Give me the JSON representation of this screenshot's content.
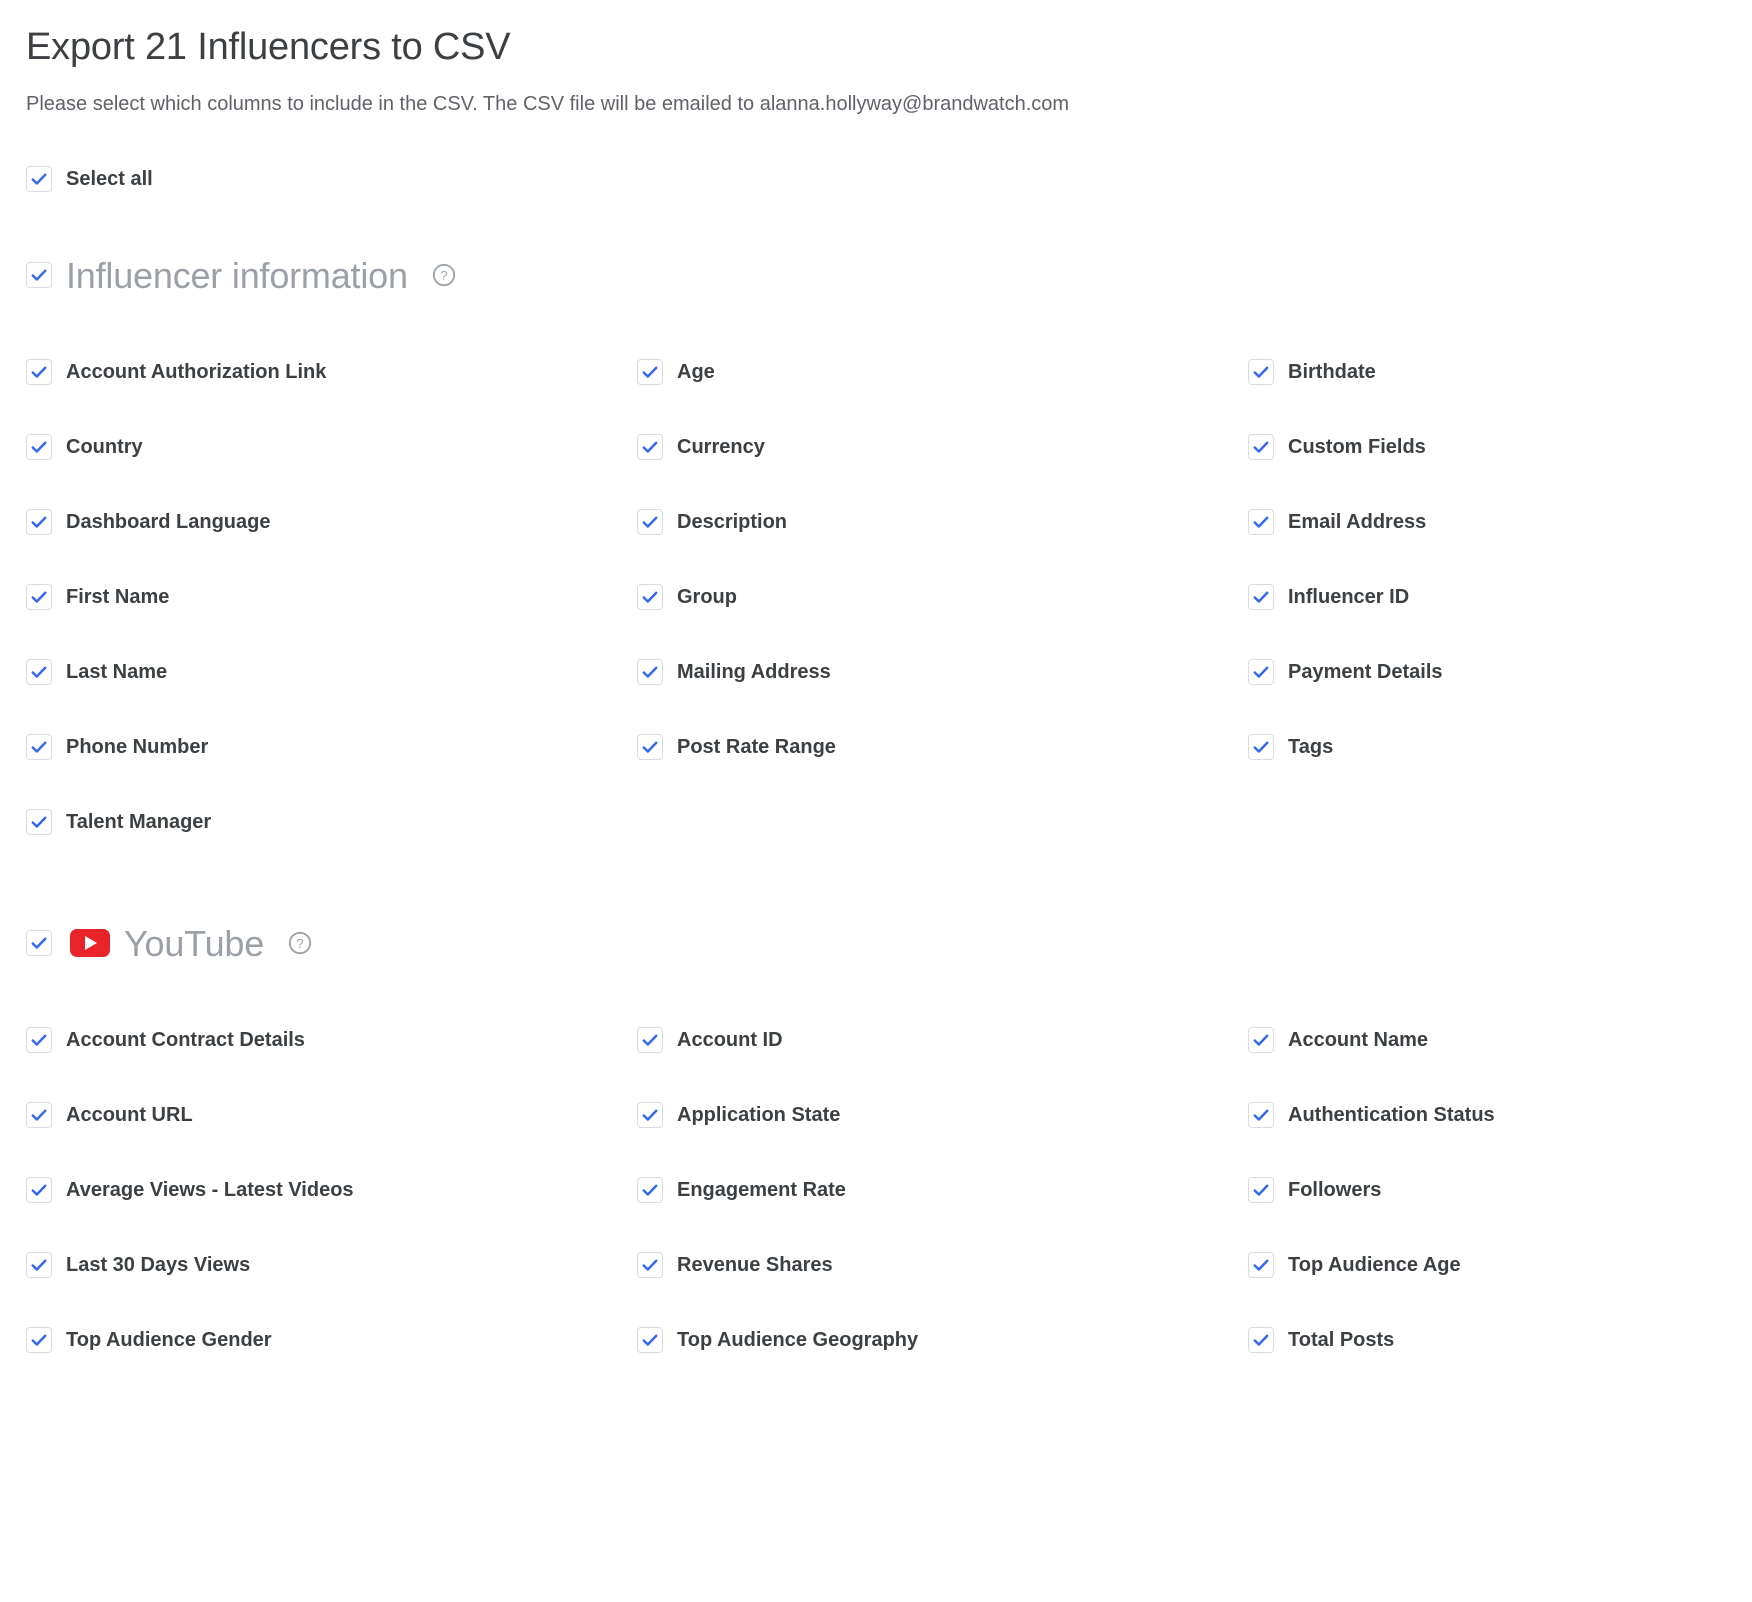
{
  "dialog": {
    "title": "Export 21 Influencers to CSV",
    "subtitle": "Please select which columns to include in the CSV. The CSV file will be emailed to alanna.hollyway@brandwatch.com",
    "select_all_label": "Select all"
  },
  "colors": {
    "accent": "#1a73e8",
    "checkmark": "#3367f0",
    "title_text": "#3c4043",
    "subtitle_text": "#5f6368",
    "section_title": "#9aa0a6",
    "checkbox_border": "#dadce0",
    "youtube_red": "#e8242a",
    "help_icon": "#9aa0a6"
  },
  "sections": [
    {
      "id": "influencer-information",
      "title": "Influencer information",
      "checked": true,
      "has_help_icon": true,
      "help_icon": "help-circle-icon",
      "logo": null,
      "items": [
        {
          "label": "Account Authorization Link",
          "checked": true
        },
        {
          "label": "Age",
          "checked": true
        },
        {
          "label": "Birthdate",
          "checked": true
        },
        {
          "label": "Country",
          "checked": true
        },
        {
          "label": "Currency",
          "checked": true
        },
        {
          "label": "Custom Fields",
          "checked": true
        },
        {
          "label": "Dashboard Language",
          "checked": true
        },
        {
          "label": "Description",
          "checked": true
        },
        {
          "label": "Email Address",
          "checked": true
        },
        {
          "label": "First Name",
          "checked": true
        },
        {
          "label": "Group",
          "checked": true
        },
        {
          "label": "Influencer ID",
          "checked": true
        },
        {
          "label": "Last Name",
          "checked": true
        },
        {
          "label": "Mailing Address",
          "checked": true
        },
        {
          "label": "Payment Details",
          "checked": true
        },
        {
          "label": "Phone Number",
          "checked": true
        },
        {
          "label": "Post Rate Range",
          "checked": true
        },
        {
          "label": "Tags",
          "checked": true
        },
        {
          "label": "Talent Manager",
          "checked": true
        }
      ]
    },
    {
      "id": "youtube",
      "title": "YouTube",
      "checked": true,
      "has_help_icon": true,
      "help_icon": "help-circle-icon",
      "logo": "youtube-logo-icon",
      "items": [
        {
          "label": "Account Contract Details",
          "checked": true
        },
        {
          "label": "Account ID",
          "checked": true
        },
        {
          "label": "Account Name",
          "checked": true
        },
        {
          "label": "Account URL",
          "checked": true
        },
        {
          "label": "Application State",
          "checked": true
        },
        {
          "label": "Authentication Status",
          "checked": true
        },
        {
          "label": "Average Views - Latest Videos",
          "checked": true
        },
        {
          "label": "Engagement Rate",
          "checked": true
        },
        {
          "label": "Followers",
          "checked": true
        },
        {
          "label": "Last 30 Days Views",
          "checked": true
        },
        {
          "label": "Revenue Shares",
          "checked": true
        },
        {
          "label": "Top Audience Age",
          "checked": true
        },
        {
          "label": "Top Audience Gender",
          "checked": true
        },
        {
          "label": "Top Audience Geography",
          "checked": true
        },
        {
          "label": "Total Posts",
          "checked": true
        }
      ]
    }
  ]
}
